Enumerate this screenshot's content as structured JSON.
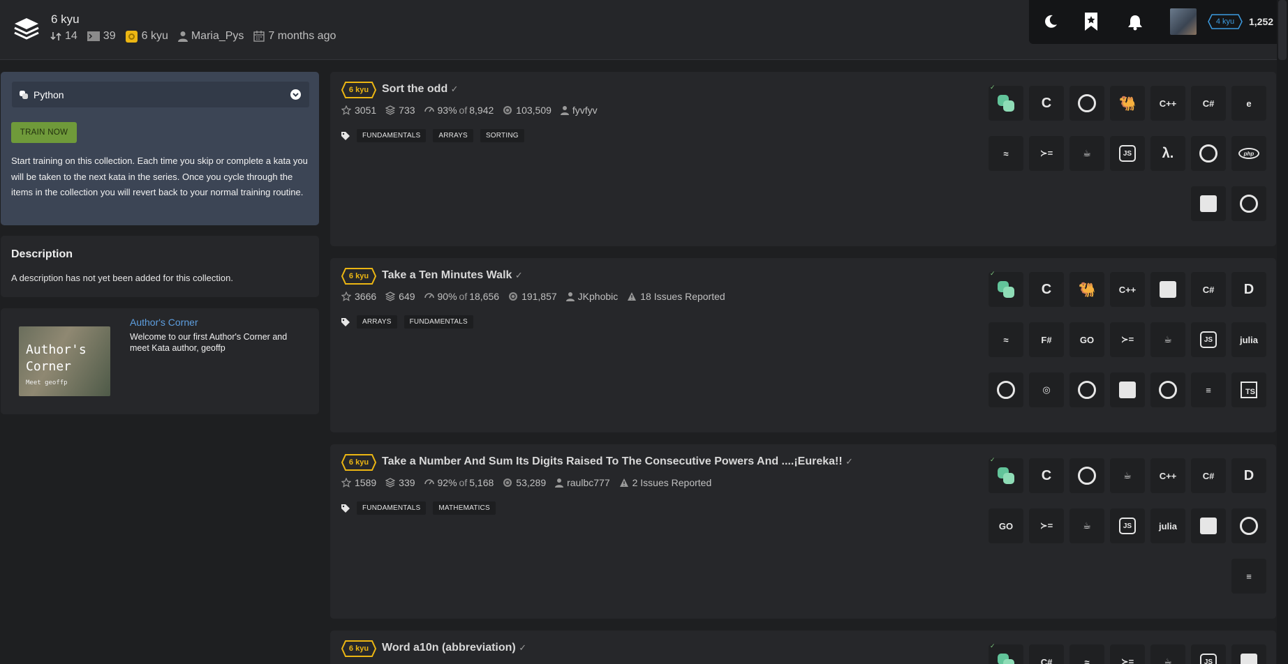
{
  "collection": {
    "title": "6 kyu",
    "kata_count": "14",
    "completed": "39",
    "rank": "6 kyu",
    "author": "Maria_Pys",
    "updated": "7 months ago"
  },
  "user": {
    "rank": "4 kyu",
    "honor": "1,252"
  },
  "sidebar": {
    "language": "Python",
    "train_button": "TRAIN NOW",
    "train_text": "Start training on this collection. Each time you skip or complete a kata you will be taken to the next kata in the series. Once you cycle through the items in the collection you will revert back to your normal training routine.",
    "description_title": "Description",
    "description_text": "A description has not yet been added for this collection.",
    "authors_corner": {
      "image_title": "Author's Corner",
      "image_sub": "Meet geoffp",
      "title": "Author's Corner",
      "text": "Welcome to our first Author's Corner and meet Kata author, geoffp"
    }
  },
  "katas": [
    {
      "rank": "6 kyu",
      "name": "Sort the odd",
      "stars": "3051",
      "collections": "733",
      "satisfaction": "93%",
      "of": "of",
      "votes": "8,942",
      "completions": "103,509",
      "author": "fyvfyv",
      "issues": "",
      "tags": [
        "FUNDAMENTALS",
        "ARRAYS",
        "SORTING"
      ]
    },
    {
      "rank": "6 kyu",
      "name": "Take a Ten Minutes Walk",
      "stars": "3666",
      "collections": "649",
      "satisfaction": "90%",
      "of": "of",
      "votes": "18,656",
      "completions": "191,857",
      "author": "JKphobic",
      "issues": "18 Issues Reported",
      "tags": [
        "ARRAYS",
        "FUNDAMENTALS"
      ]
    },
    {
      "rank": "6 kyu",
      "name": "Take a Number And Sum Its Digits Raised To The Consecutive Powers And ....¡Eureka!!",
      "stars": "1589",
      "collections": "339",
      "satisfaction": "92%",
      "of": "of",
      "votes": "5,168",
      "completions": "53,289",
      "author": "raulbc777",
      "issues": "2 Issues Reported",
      "tags": [
        "FUNDAMENTALS",
        "MATHEMATICS"
      ]
    },
    {
      "rank": "6 kyu",
      "name": "Word a10n (abbreviation)"
    }
  ],
  "lang_glyphs": {
    "c": "C",
    "cpp": "C++",
    "csharp": "C#",
    "lambda": "λ.",
    "fsharp": "F#",
    "go": "GO",
    "haskell": "≻=",
    "java": "☕",
    "js": "JS",
    "julia": "julia",
    "php": "php",
    "ts": "TS",
    "dart": "D",
    "scala": "≡",
    "elixir": "e",
    "owl": "◎",
    "clojure": "@",
    "ocaml": "🐫"
  },
  "colors": {
    "accent_rank": "#ecb613",
    "user_rank": "#3c9be0",
    "link": "#5e9fe0",
    "train_button": "#6f9a3a",
    "python": "#62c49a"
  }
}
